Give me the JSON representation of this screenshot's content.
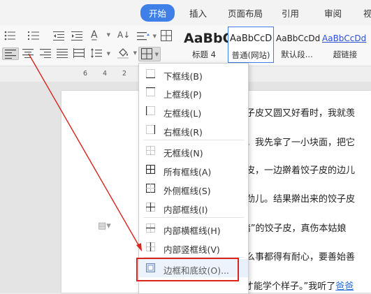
{
  "tabs": [
    "开始",
    "插入",
    "页面布局",
    "引用",
    "审阅",
    "视"
  ],
  "active_tab": "开始",
  "styles": [
    {
      "sample": "AaBbC",
      "name": "标题 4"
    },
    {
      "sample": "AaBbCcD",
      "name": "普通(网站)"
    },
    {
      "sample": "AaBbCcDd",
      "name": "默认段..."
    },
    {
      "sample": "AaBbCcDd",
      "name": "超链接"
    }
  ],
  "ruler_numbers": [
    "6",
    "4",
    "2"
  ],
  "border_menu": {
    "items": [
      {
        "label": "下框线(B)",
        "icon": "border-bottom-icon"
      },
      {
        "label": "上框线(P)",
        "icon": "border-top-icon"
      },
      {
        "label": "左框线(L)",
        "icon": "border-left-icon"
      },
      {
        "label": "右框线(R)",
        "icon": "border-right-icon"
      },
      {
        "label": "无框线(N)",
        "icon": "border-none-icon"
      },
      {
        "label": "所有框线(A)",
        "icon": "border-all-icon"
      },
      {
        "label": "外侧框线(S)",
        "icon": "border-outside-icon"
      },
      {
        "label": "内部框线(I)",
        "icon": "border-inside-icon"
      },
      {
        "label": "内部横框线(H)",
        "icon": "border-inside-horizontal-icon"
      },
      {
        "label": "内部竖框线(V)",
        "icon": "border-inside-vertical-icon"
      },
      {
        "label": "边框和底纹(O)...",
        "icon": "borders-and-shading-icon"
      }
    ]
  },
  "document": {
    "lines": [
      "饺子皮又圆又好看时，我就羡",
      "它。我先拿了一小块面，把它",
      "子皮，一边擀着饺子皮的边儿",
      "得劲儿。结果擀出来的饺子皮",
      "”赌”的饺子皮，真伤本姑娘",
      "什么事都得有耐心，要善始善",
      "观察，掌握技巧。这样，才能学个样子。”我听了"
    ],
    "link_text": "爸爸"
  },
  "colors": {
    "accent": "#3f7fe8",
    "annotation": "#d9241f"
  }
}
